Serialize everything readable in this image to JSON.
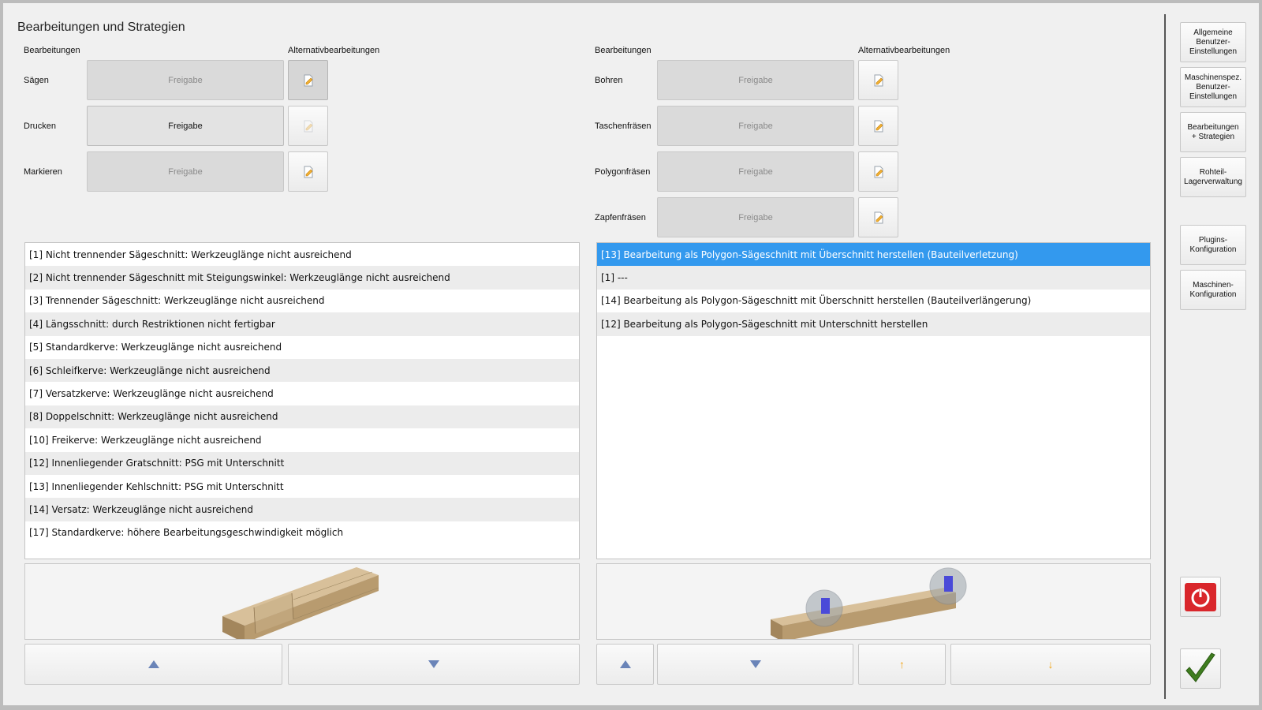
{
  "title": "Bearbeitungen und Strategien",
  "left_panel": {
    "header_bearbeitungen": "Bearbeitungen",
    "header_alternativ": "Alternativbearbeitungen",
    "rows": [
      {
        "label": "Sägen",
        "button": "Freigabe",
        "state": "disabled"
      },
      {
        "label": "Drucken",
        "button": "Freigabe",
        "state": "active"
      },
      {
        "label": "Markieren",
        "button": "Freigabe",
        "state": "disabled"
      }
    ],
    "list": [
      "[1] Nicht trennender Sägeschnitt: Werkzeuglänge nicht ausreichend",
      "[2] Nicht trennender Sägeschnitt mit Steigungswinkel: Werkzeuglänge nicht ausreichend",
      "[3] Trennender Sägeschnitt: Werkzeuglänge nicht ausreichend",
      "[4] Längsschnitt: durch Restriktionen nicht fertigbar",
      "[5] Standardkerve: Werkzeuglänge nicht ausreichend",
      "[6] Schleifkerve: Werkzeuglänge nicht ausreichend",
      "[7] Versatzkerve: Werkzeuglänge nicht ausreichend",
      "[8] Doppelschnitt: Werkzeuglänge nicht ausreichend",
      "[10] Freikerve: Werkzeuglänge nicht ausreichend",
      "[12] Innenliegender Gratschnitt: PSG mit Unterschnitt",
      "[13] Innenliegender Kehlschnitt: PSG mit Unterschnitt",
      "[14] Versatz: Werkzeuglänge nicht ausreichend",
      "[17] Standardkerve: höhere Bearbeitungsgeschwindigkeit möglich"
    ]
  },
  "right_panel": {
    "header_bearbeitungen": "Bearbeitungen",
    "header_alternativ": "Alternativbearbeitungen",
    "rows": [
      {
        "label": "Bohren",
        "button": "Freigabe",
        "state": "disabled"
      },
      {
        "label": "Taschenfräsen",
        "button": "Freigabe",
        "state": "disabled"
      },
      {
        "label": "Polygonfräsen",
        "button": "Freigabe",
        "state": "disabled"
      },
      {
        "label": "Zapfenfräsen",
        "button": "Freigabe",
        "state": "disabled"
      }
    ],
    "list": [
      "[13] Bearbeitung als Polygon-Sägeschnitt mit Überschnitt herstellen (Bauteilverletzung)",
      "[1] ---",
      "[14] Bearbeitung als Polygon-Sägeschnitt mit Überschnitt herstellen (Bauteilverlängerung)",
      "[12] Bearbeitung als Polygon-Sägeschnitt mit Unterschnitt herstellen"
    ],
    "selected_index": 0
  },
  "sidebar": {
    "buttons": [
      "Allgemeine\nBenutzer-\nEinstellungen",
      "Maschinenspez.\nBenutzer-\nEinstellungen",
      "Bearbeitungen\n+ Strategien",
      "Rohteil-\nLagerverwaltung",
      "Plugins-\nKonfiguration",
      "Maschinen-\nKonfiguration"
    ]
  },
  "colors": {
    "selection": "#3399ee",
    "power": "#d9262b",
    "check": "#3f7d1f",
    "nav_arrow": "#6a84b8",
    "priority_arrow": "#f2a516"
  },
  "icons": [
    "edit-icon",
    "arrow-up-icon",
    "arrow-down-icon",
    "power-icon",
    "checkmark-icon"
  ]
}
